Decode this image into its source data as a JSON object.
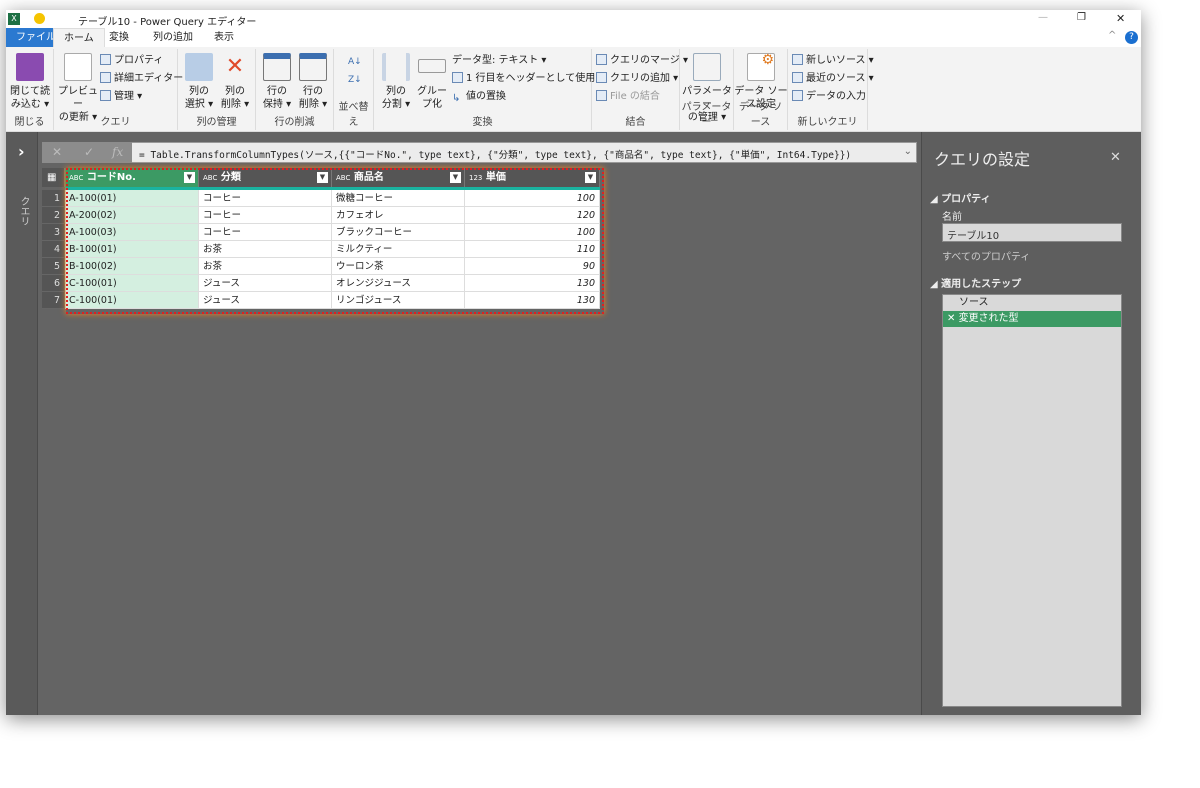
{
  "window": {
    "title": "テーブル10 - Power Query エディター",
    "minimize": "—",
    "restore": "❐",
    "close": "✕"
  },
  "tabs": [
    "ファイル",
    "ホーム",
    "変換",
    "列の追加",
    "表示"
  ],
  "ribbon": {
    "close": {
      "btn": "閉じて読\nみ込む ▾",
      "label": "閉じる"
    },
    "query": {
      "refresh": "プレビュー\nの更新 ▾",
      "properties": "プロパティ",
      "advanced": "詳細エディター",
      "manage": "管理 ▾",
      "label": "クエリ"
    },
    "columns": {
      "choose": "列の\n選択 ▾",
      "remove": "列の\n削除 ▾",
      "label": "列の管理"
    },
    "rows": {
      "keep": "行の\n保持 ▾",
      "remove": "行の\n削除 ▾",
      "label": "行の削減"
    },
    "sort": {
      "label": "並べ替え"
    },
    "transform": {
      "split": "列の\n分割 ▾",
      "group": "グルー\nプ化",
      "datatype": "データ型: テキスト ▾",
      "header": "1 行目をヘッダーとして使用 ▾",
      "replace": "値の置換",
      "label": "変換"
    },
    "combine": {
      "merge": "クエリのマージ ▾",
      "append": "クエリの追加 ▾",
      "files": "File の結合",
      "label": "結合"
    },
    "params": {
      "manage": "パラメーター\nの管理 ▾",
      "label": "パラメーター"
    },
    "datasource": {
      "settings": "データ ソー\nス設定",
      "label": "データ ソース"
    },
    "newquery": {
      "new": "新しいソース ▾",
      "recent": "最近のソース ▾",
      "enter": "データの入力",
      "label": "新しいクエリ"
    }
  },
  "sidebar": {
    "label": "クエリ",
    "expand": "›"
  },
  "formula": "= Table.TransformColumnTypes(ソース,{{\"コードNo.\", type text}, {\"分類\", type text}, {\"商品名\", type text}, {\"単価\", Int64.Type}})",
  "table": {
    "columns": [
      {
        "type": "ABC",
        "name": "コードNo."
      },
      {
        "type": "ABC",
        "name": "分類"
      },
      {
        "type": "ABC",
        "name": "商品名"
      },
      {
        "type": "123",
        "name": "単価"
      }
    ],
    "rows": [
      [
        "1",
        "A-100(01)",
        "コーヒー",
        "微糖コーヒー",
        "100"
      ],
      [
        "2",
        "A-200(02)",
        "コーヒー",
        "カフェオレ",
        "120"
      ],
      [
        "3",
        "A-100(03)",
        "コーヒー",
        "ブラックコーヒー",
        "100"
      ],
      [
        "4",
        "B-100(01)",
        "お茶",
        "ミルクティー",
        "110"
      ],
      [
        "5",
        "B-100(02)",
        "お茶",
        "ウーロン茶",
        "90"
      ],
      [
        "6",
        "C-100(01)",
        "ジュース",
        "オレンジジュース",
        "130"
      ],
      [
        "7",
        "C-100(01)",
        "ジュース",
        "リンゴジュース",
        "130"
      ]
    ]
  },
  "settings": {
    "title": "クエリの設定",
    "properties": "プロパティ",
    "name_label": "名前",
    "name_value": "テーブル10",
    "all_props": "すべてのプロパティ",
    "steps_label": "適用したステップ",
    "steps": [
      "ソース",
      "変更された型"
    ]
  },
  "colors": {
    "accent": "#3c9a64",
    "file_tab": "#2b79d0",
    "highlight": "#e02020"
  }
}
